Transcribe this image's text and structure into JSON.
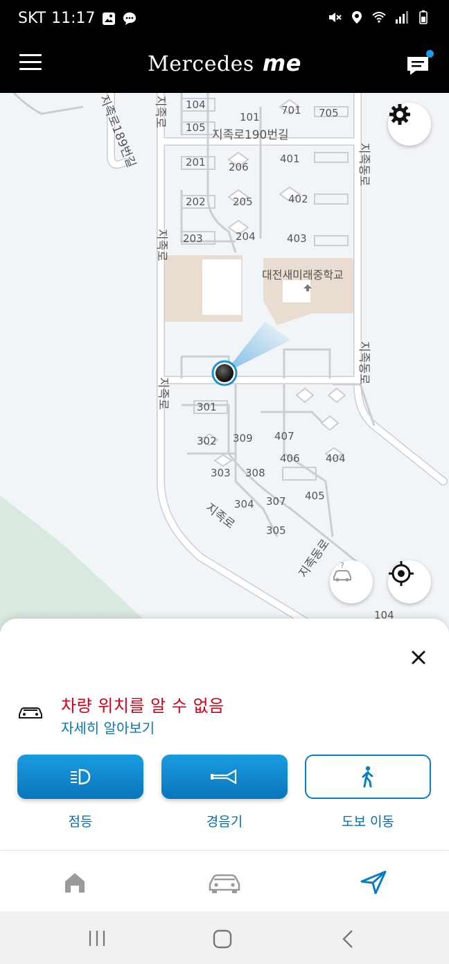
{
  "status_bar": {
    "carrier": "SKT",
    "time": "11:17"
  },
  "header": {
    "brand": "Mercedes",
    "brand_suffix": "me"
  },
  "map": {
    "labels": [
      {
        "text": "104"
      },
      {
        "text": "105"
      },
      {
        "text": "101"
      },
      {
        "text": "701"
      },
      {
        "text": "705"
      },
      {
        "text": "지족로190번길"
      },
      {
        "text": "201"
      },
      {
        "text": "206"
      },
      {
        "text": "401"
      },
      {
        "text": "202"
      },
      {
        "text": "205"
      },
      {
        "text": "402"
      },
      {
        "text": "203"
      },
      {
        "text": "204"
      },
      {
        "text": "403"
      },
      {
        "text": "대전새미래중학교"
      },
      {
        "text": "301"
      },
      {
        "text": "302"
      },
      {
        "text": "309"
      },
      {
        "text": "407"
      },
      {
        "text": "406"
      },
      {
        "text": "404"
      },
      {
        "text": "303"
      },
      {
        "text": "308"
      },
      {
        "text": "304"
      },
      {
        "text": "307"
      },
      {
        "text": "405"
      },
      {
        "text": "305"
      },
      {
        "text": "104"
      },
      {
        "text": "지족로189번길"
      },
      {
        "text": "지족로"
      },
      {
        "text": "지족로"
      },
      {
        "text": "지족로"
      },
      {
        "text": "지족동로"
      },
      {
        "text": "지족동로"
      },
      {
        "text": "지족동로"
      },
      {
        "text": "지족로"
      }
    ],
    "settings_button": "gear-icon",
    "locate_button": "crosshair-icon",
    "car_unknown_button": "car-question-icon",
    "colors": {
      "background": "#f2f5f8",
      "school_area": "#e8ddd0",
      "green_area": "#d9e9e0",
      "location_dot": "#1e90d6"
    }
  },
  "sheet": {
    "warning_title": "차량 위치를 알 수 없음",
    "learn_more": "자세히 알아보기",
    "actions": [
      {
        "label": "점등",
        "icon": "headlight-icon"
      },
      {
        "label": "경음기",
        "icon": "horn-icon"
      },
      {
        "label": "도보 이동",
        "icon": "walking-person-icon"
      }
    ]
  },
  "bottom_nav": {
    "items": [
      "home-icon",
      "car-icon",
      "navigate-icon"
    ]
  }
}
